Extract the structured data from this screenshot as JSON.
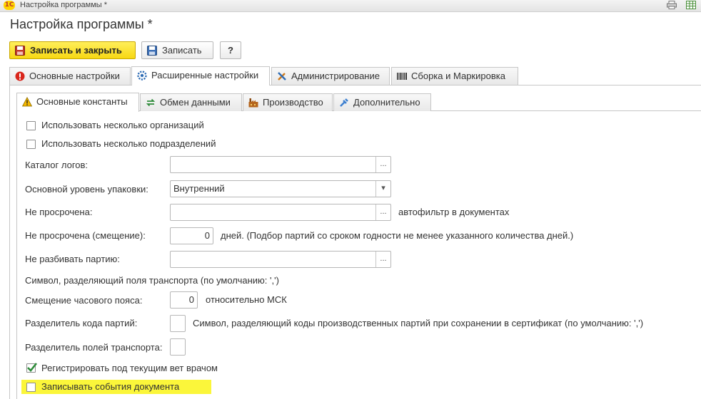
{
  "window": {
    "title_bar_text": "Настройка программы *",
    "logo_text": "1С"
  },
  "page": {
    "title": "Настройка программы *"
  },
  "toolbar": {
    "save_close_label": "Записать и закрыть",
    "save_label": "Записать",
    "help_label": "?"
  },
  "main_tabs": [
    {
      "label": "Основные настройки",
      "icon": "warning-icon"
    },
    {
      "label": "Расширенные настройки",
      "icon": "settings-icon"
    },
    {
      "label": "Администрирование",
      "icon": "tools-icon"
    },
    {
      "label": "Сборка и Маркировка",
      "icon": "barcode-icon"
    }
  ],
  "sub_tabs": [
    {
      "label": "Основные константы",
      "icon": "warning-icon"
    },
    {
      "label": "Обмен данными",
      "icon": "exchange-icon"
    },
    {
      "label": "Производство",
      "icon": "factory-icon"
    },
    {
      "label": "Дополнительно",
      "icon": "puzzle-icon"
    }
  ],
  "form": {
    "multi_org": {
      "label": "Использовать несколько организаций",
      "checked": false
    },
    "multi_dept": {
      "label": "Использовать несколько подразделений",
      "checked": false
    },
    "log_catalog": {
      "label": "Каталог логов:",
      "value": ""
    },
    "pack_level": {
      "label": "Основной уровень упаковки:",
      "value": "Внутренний"
    },
    "not_expired": {
      "label": "Не просрочена:",
      "value": "",
      "note": "автофильтр в документах"
    },
    "not_expired_offset": {
      "label": "Не просрочена (смещение):",
      "value": "0",
      "note": "дней. (Подбор партий со сроком годности не менее указанного количества дней.)"
    },
    "no_split_batch": {
      "label": "Не разбивать партию:",
      "value": ""
    },
    "transport_separator_note": "Символ, разделяющий поля  транспорта  (по умолчанию: ',')",
    "tz_offset": {
      "label": "Смещение часового пояса:",
      "value": "0",
      "note": "относительно МСК"
    },
    "batch_code_sep": {
      "label": "Разделитель кода партий:",
      "value": "",
      "note": "Символ, разделяющий коды производственных партий при сохранении в сертификат (по умолчанию: ',')"
    },
    "transport_field_sep": {
      "label": "Разделитель полей транспорта:",
      "value": ""
    },
    "register_vet": {
      "label": "Регистрировать под текущим вет врачом",
      "checked": true
    },
    "log_doc_events": {
      "label": "Записывать события документа",
      "checked": false
    }
  },
  "colors": {
    "primary_button": "#f7d813",
    "highlight": "#fbf63a",
    "check_green": "#2e8b3a"
  }
}
